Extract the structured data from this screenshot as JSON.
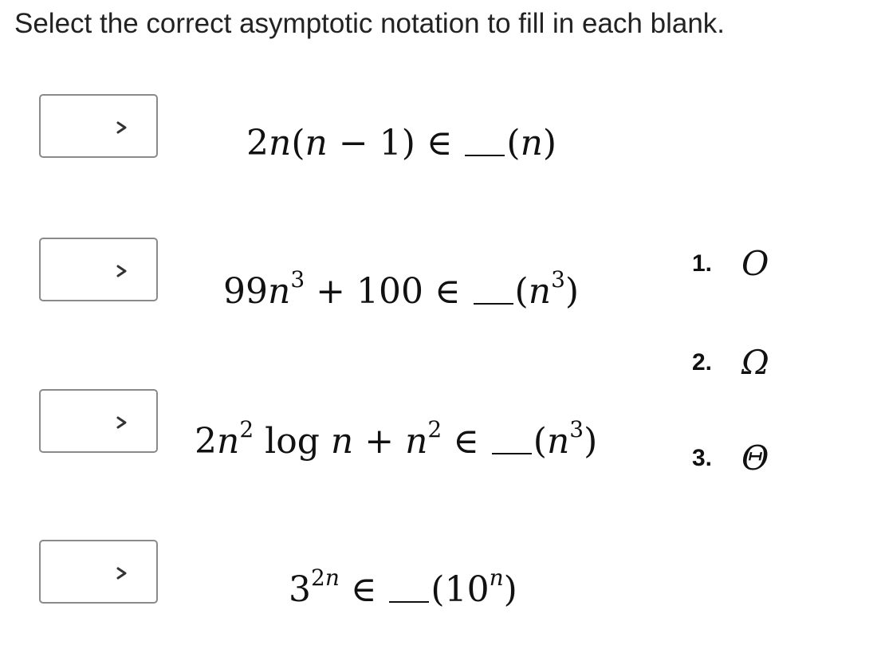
{
  "prompt": "Select the correct asymptotic notation to fill in each blank.",
  "rows": [
    {
      "select_value": "",
      "icon": "chevron-down-icon",
      "expr_pre": "2n(n − 1) ∈ ",
      "expr_post": "(n)"
    },
    {
      "select_value": "",
      "icon": "chevron-down-icon",
      "expr_pre": "99n³ + 100 ∈ ",
      "expr_post": "(n³)"
    },
    {
      "select_value": "",
      "icon": "chevron-down-icon",
      "expr_pre": "2n² log n + n² ∈ ",
      "expr_post": "(n³)"
    },
    {
      "select_value": "",
      "icon": "chevron-down-icon",
      "expr_pre": "3²ⁿ ∈ ",
      "expr_post": "(10ⁿ)"
    }
  ],
  "options": [
    {
      "number": "1.",
      "symbol": "O"
    },
    {
      "number": "2.",
      "symbol": "Ω"
    },
    {
      "number": "3.",
      "symbol": "Θ"
    }
  ]
}
